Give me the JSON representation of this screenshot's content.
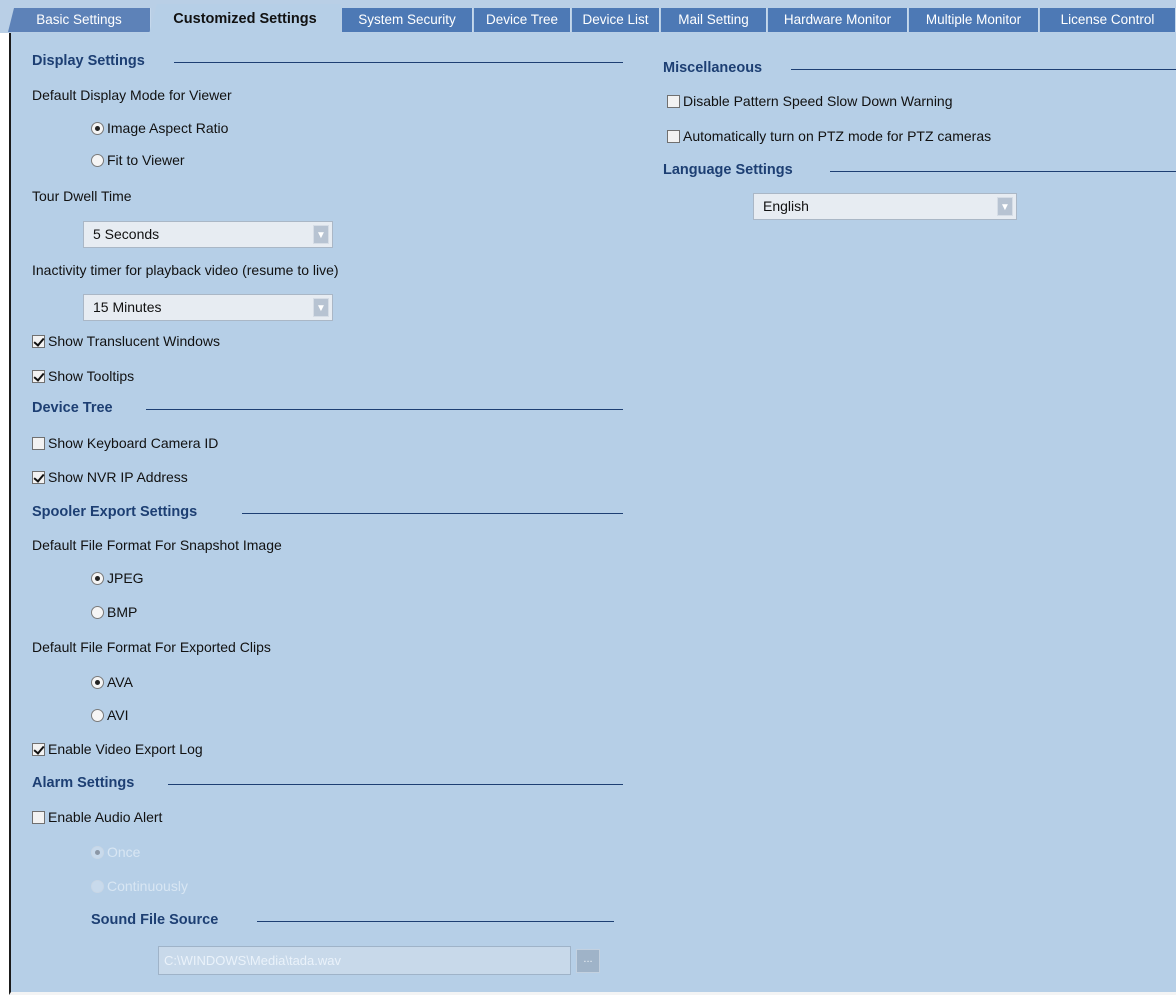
{
  "tabs": [
    {
      "label": "Basic Settings"
    },
    {
      "label": "Customized Settings"
    },
    {
      "label": "System Security"
    },
    {
      "label": "Device Tree"
    },
    {
      "label": "Device List"
    },
    {
      "label": "Mail Setting"
    },
    {
      "label": "Hardware Monitor"
    },
    {
      "label": "Multiple Monitor"
    },
    {
      "label": "License Control"
    }
  ],
  "active_tab": "Customized Settings",
  "display_settings": {
    "title": "Display Settings",
    "display_mode_label": "Default Display Mode for Viewer",
    "opt_aspect": "Image Aspect Ratio",
    "opt_fit": "Fit to Viewer",
    "selected_mode": "Image Aspect Ratio",
    "tour_dwell_label": "Tour Dwell Time",
    "tour_dwell_value": "5 Seconds",
    "inactivity_label": "Inactivity timer for playback video (resume to live)",
    "inactivity_value": "15 Minutes",
    "translucent_label": "Show Translucent Windows",
    "translucent_checked": true,
    "tooltips_label": "Show Tooltips",
    "tooltips_checked": true
  },
  "device_tree": {
    "title": "Device Tree",
    "keyboard_id_label": "Show Keyboard Camera ID",
    "keyboard_id_checked": false,
    "nvr_ip_label": "Show NVR IP Address",
    "nvr_ip_checked": true
  },
  "spooler": {
    "title": "Spooler Export Settings",
    "snapshot_label": "Default File Format For Snapshot Image",
    "opt_jpeg": "JPEG",
    "opt_bmp": "BMP",
    "selected_snapshot": "JPEG",
    "clips_label": "Default File Format For Exported Clips",
    "opt_ava": "AVA",
    "opt_avi": "AVI",
    "selected_clip": "AVA",
    "export_log_label": "Enable Video Export Log",
    "export_log_checked": true
  },
  "alarm": {
    "title": "Alarm Settings",
    "audio_alert_label": "Enable Audio Alert",
    "audio_alert_checked": false,
    "opt_once": "Once",
    "opt_continuously": "Continuously",
    "selected_repeat": "Once",
    "sound_source_title": "Sound File Source",
    "sound_path": "C:\\WINDOWS\\Media\\tada.wav",
    "browse_label": "..."
  },
  "misc": {
    "title": "Miscellaneous",
    "pattern_warning_label": "Disable Pattern Speed Slow Down Warning",
    "pattern_warning_checked": false,
    "ptz_label": "Automatically turn on PTZ mode for PTZ cameras",
    "ptz_checked": false
  },
  "language": {
    "title": "Language Settings",
    "value": "English"
  }
}
